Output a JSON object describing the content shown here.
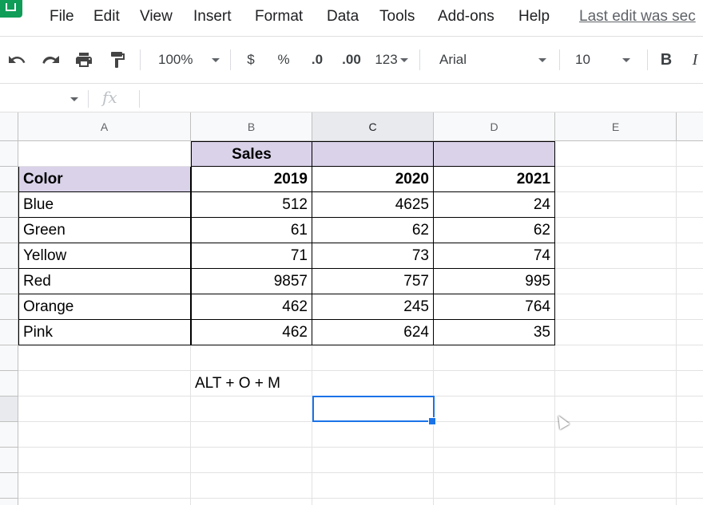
{
  "menu": {
    "items": [
      "File",
      "Edit",
      "View",
      "Insert",
      "Format",
      "Data",
      "Tools",
      "Add-ons",
      "Help"
    ],
    "last_edit": "Last edit was sec"
  },
  "toolbar": {
    "zoom": "100%",
    "currency": "$",
    "percent": "%",
    "decrease_decimal": ".0",
    "increase_decimal": ".00",
    "more_formats": "123",
    "font": "Arial",
    "font_size": "10",
    "bold": "B",
    "italic": "I"
  },
  "formula_bar": {
    "fx": "fx",
    "name_box": "",
    "content": ""
  },
  "columns": [
    "A",
    "B",
    "C",
    "D",
    "E"
  ],
  "active_column": "C",
  "sheet": {
    "title_cell": "Sales",
    "header": [
      "Color",
      "2019",
      "2020",
      "2021"
    ],
    "rows": [
      [
        "Blue",
        "512",
        "4625",
        "24"
      ],
      [
        "Green",
        "61",
        "62",
        "62"
      ],
      [
        "Yellow",
        "71",
        "73",
        "74"
      ],
      [
        "Red",
        "9857",
        "757",
        "995"
      ],
      [
        "Orange",
        "462",
        "245",
        "764"
      ],
      [
        "Pink",
        "462",
        "624",
        "35"
      ]
    ],
    "note": "ALT + O + M"
  },
  "colors": {
    "header_fill": "#d9d2e9",
    "selection": "#1a73e8",
    "sheets_green": "#0f9d58"
  }
}
